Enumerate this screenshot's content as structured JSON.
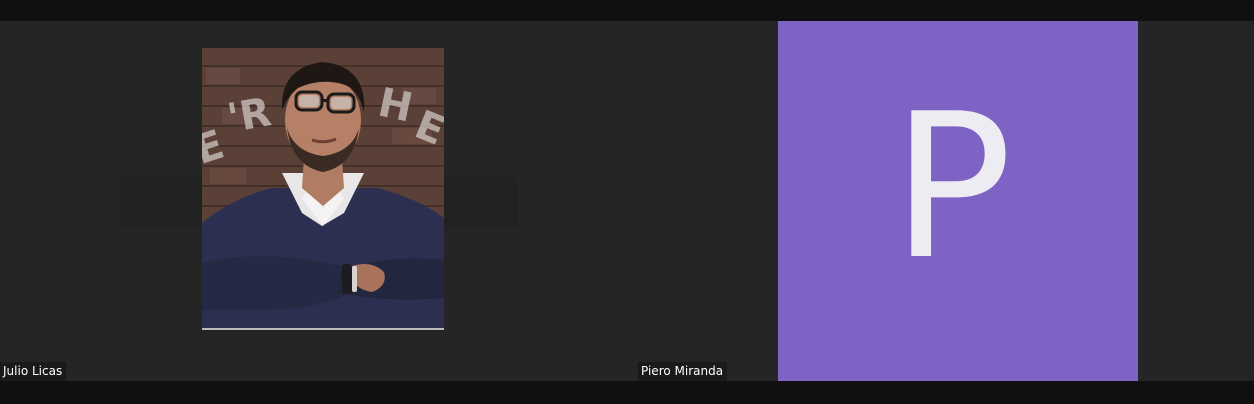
{
  "meeting": {
    "participants": [
      {
        "name": "Julio Licas",
        "display": "profile-photo"
      },
      {
        "name": "Piero Miranda",
        "display": "avatar-initial",
        "initial": "P",
        "avatar_color": "#7e62c4"
      }
    ]
  },
  "colors": {
    "background": "#252525",
    "chrome": "#101010",
    "name_tag_bg": "#1a1a1a"
  }
}
